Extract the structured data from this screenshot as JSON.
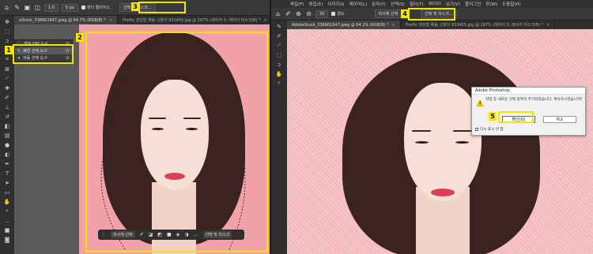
{
  "left": {
    "optbar": {
      "ps_icon": "home-icon",
      "px_label": "1.0",
      "px_value": "5 px",
      "antialias_label": "앤티 앨리어스",
      "select_mask_button": "선택 및 마스크..."
    },
    "tabs": [
      {
        "label": "eStock_338661647.jpeg @ 64.7% (RGB/8) *",
        "active": true
      },
      {
        "label": "Firefly 생성형 채움 고장이 933455.jpg @ 187% (레이어 0, 레이어 마스크/8) *",
        "active": false
      }
    ],
    "flyout": [
      {
        "label": "개체 선택 도구",
        "key": "W",
        "selected": false
      },
      {
        "label": "빠른 선택 도구",
        "key": "W",
        "selected": true
      },
      {
        "label": "자동 선택 도구",
        "key": "W",
        "selected": false
      }
    ],
    "contextbar": {
      "select_subject": "피사체 선택",
      "select_mask": "선택 및 마스크"
    }
  },
  "right": {
    "menubar": [
      "파일(F)",
      "편집(E)",
      "이미지(I)",
      "레이어(L)",
      "문자(Y)",
      "선택(S)",
      "필터(T)",
      "3D(D)",
      "보기(V)",
      "플러그인",
      "창(W)",
      "도움말(H)"
    ],
    "optbar": {
      "size_value": "30",
      "hardness": "경도",
      "select_subject": "피사체 선택",
      "select_mask_button": "선택 및 마스크..."
    },
    "tabs": [
      {
        "label": "AdobeStock_338661647.jpeg @ 64.2% (RGB/8) *",
        "active": true
      },
      {
        "label": "Firefly 생성형 채움 고장이 933455.jpg @ 187% (레이어 0, 레이어 마스크/8) *",
        "active": false
      }
    ]
  },
  "dialog": {
    "title": "Adobe Photoshop",
    "message": "작업 중 새로운 선택 항목이 추가되었습니다. 계속하시겠습니까?",
    "ok_label": "확인(O)",
    "cancel_label": "취소",
    "checkbox_label": "다시 표시 안 함"
  },
  "badges": [
    "1",
    "2",
    "3",
    "4",
    "5"
  ],
  "colors": {
    "highlight": "#f2e600",
    "canvas_pink": "#f0a2a8",
    "ui_dark": "#282828"
  }
}
